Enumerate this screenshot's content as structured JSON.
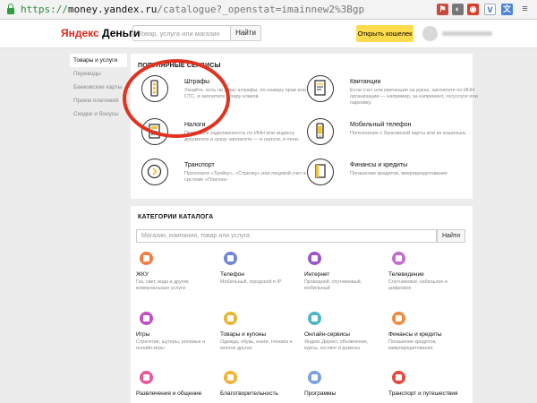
{
  "browser": {
    "url_scheme": "https://",
    "url_host": "money.yandex.ru",
    "url_path": "/catalogue?_openstat=imainnew2%3Bgp"
  },
  "header": {
    "logo_ya": "Яндекс",
    "logo_rest": " Деньги",
    "search_placeholder": "Товар, услуга или магазин",
    "search_button": "Найти",
    "open_wallet_button": "Открыть кошелек"
  },
  "sidebar": {
    "items": [
      {
        "label": "Товары и услуги"
      },
      {
        "label": "Переводы"
      },
      {
        "label": "Банковские карты"
      },
      {
        "label": "Прием платежей"
      },
      {
        "label": "Скидки и бонусы"
      }
    ]
  },
  "popular": {
    "title": "ПОПУЛЯРНЫЕ СЕРВИСЫ",
    "items": [
      {
        "title": "Штрафы",
        "desc": "Узнайте, есть ли у вас штрафы, по номеру прав или СТС, и заплатите в пару кликов.",
        "icon": "traffic-light-icon"
      },
      {
        "title": "Квитанции",
        "desc": "Если счет или квитанция на руках, заплатите по ИНН организации — например, за капремонт, госуслуги или парковку.",
        "icon": "receipt-icon"
      },
      {
        "title": "Налоги",
        "desc": "Проверьте задолженность по ИНН или индексу документа и сразу заплатите — и налоги, и пени.",
        "icon": "calculator-icon"
      },
      {
        "title": "Мобильный телефон",
        "desc": "Пополнение с банковской карты или из кошелька.",
        "icon": "phone-icon"
      },
      {
        "title": "Транспорт",
        "desc": "Пополните «Тройку», «Стрелку» или лицевой счет в системе «Платон»",
        "icon": "transport-card-icon"
      },
      {
        "title": "Финансы и кредиты",
        "desc": "Погашение кредитов, микрокредитование",
        "icon": "finance-book-icon"
      }
    ]
  },
  "catalogue": {
    "title": "КАТЕГОРИИ КАТАЛОГА",
    "search_placeholder": "Магазин, компания, товар или услуга",
    "search_button": "Найти",
    "categories": [
      {
        "title": "ЖКУ",
        "desc": "Газ, свет, вода и другие коммунальные услуги",
        "color": "#f47c43",
        "icon": "house-icon"
      },
      {
        "title": "Телефон",
        "desc": "Мобильный, городской и IP",
        "color": "#6f86d6",
        "icon": "phone-icon"
      },
      {
        "title": "Интернет",
        "desc": "Проводной, спутниковый, мобильный",
        "color": "#9b55c9",
        "icon": "globe-icon"
      },
      {
        "title": "Телевидение",
        "desc": "Спутниковое, кабельное и цифровое",
        "color": "#c46bd0",
        "icon": "tv-icon"
      },
      {
        "title": "Игры",
        "desc": "Стратегии, шутеры, ролевые и онлайн-игры",
        "color": "#c350c0",
        "icon": "gamepad-icon"
      },
      {
        "title": "Товары и купоны",
        "desc": "Одежда, обувь, книги, техника и многое другое",
        "color": "#e9b530",
        "icon": "cart-icon"
      },
      {
        "title": "Онлайн-сервисы",
        "desc": "Яндекс.Директ, объявления, курсы, хостинг и домены",
        "color": "#4cb5c9",
        "icon": "cloud-icon"
      },
      {
        "title": "Финансы и кредиты",
        "desc": "Погашение кредитов, микрокредитование",
        "color": "#f08b3c",
        "icon": "finance-icon"
      },
      {
        "title": "Развлечения и общение",
        "desc": "",
        "color": "#e85a9a",
        "icon": "chat-icon"
      },
      {
        "title": "Благотворительность",
        "desc": "",
        "color": "#f2b233",
        "icon": "heart-icon"
      },
      {
        "title": "Программы",
        "desc": "",
        "color": "#7aa0dd",
        "icon": "program-icon"
      },
      {
        "title": "Транспорт и путешествия",
        "desc": "",
        "color": "#e5483c",
        "icon": "plane-icon"
      }
    ]
  },
  "colors": {
    "accent_yellow": "#ffdb4d",
    "annotation_red": "#e2321f",
    "logo_red": "#e1261c"
  }
}
